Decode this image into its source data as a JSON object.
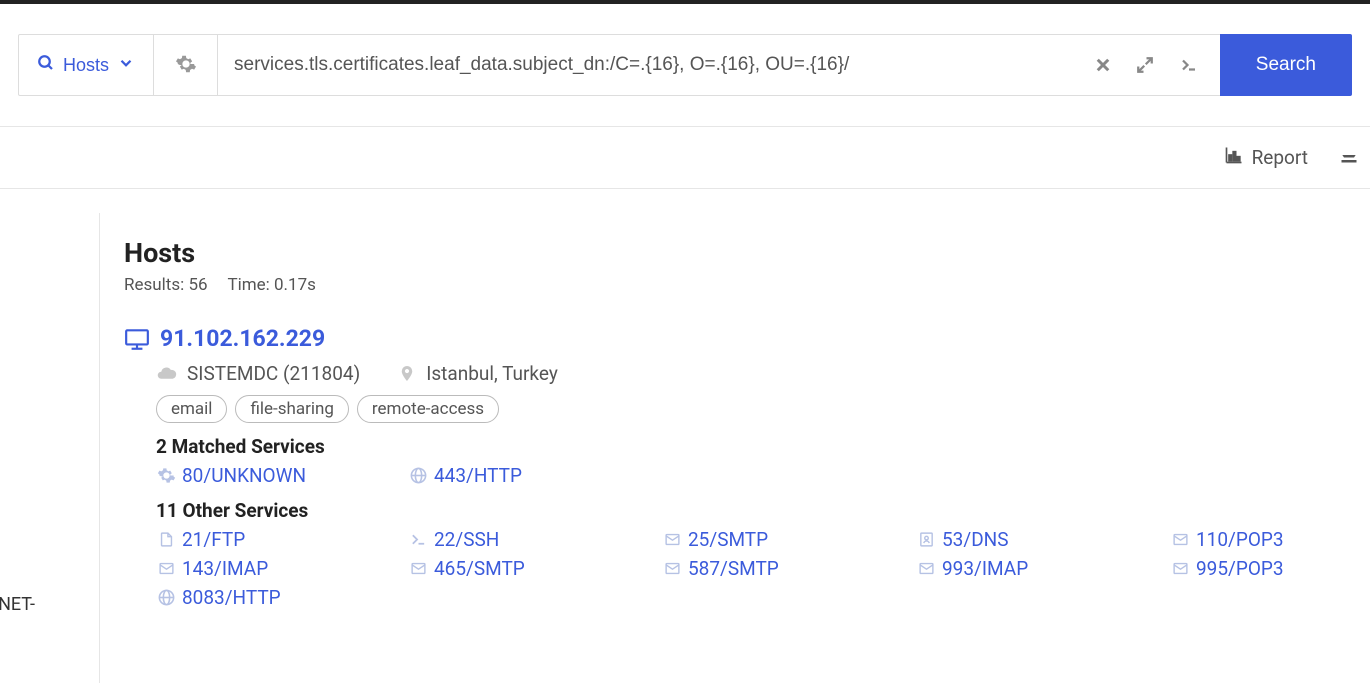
{
  "search": {
    "scope_label": "Hosts",
    "query": "services.tls.certificates.leaf_data.subject_dn:/C=.{16}, O=.{16}, OU=.{16}/",
    "button_label": "Search"
  },
  "subbar": {
    "report_label": "Report"
  },
  "results": {
    "heading": "Hosts",
    "results_label": "Results: 56",
    "time_label": "Time: 0.17s"
  },
  "sidebar": {
    "net_fragment": "NET-"
  },
  "host": {
    "ip": "91.102.162.229",
    "asn": "SISTEMDC (211804)",
    "location": "Istanbul, Turkey",
    "tags": [
      "email",
      "file-sharing",
      "remote-access"
    ],
    "matched_heading": "2 Matched Services",
    "matched": [
      {
        "icon": "gear",
        "label": "80/UNKNOWN"
      },
      {
        "icon": "globe",
        "label": "443/HTTP"
      }
    ],
    "other_heading": "11 Other Services",
    "other": [
      {
        "icon": "file",
        "label": "21/FTP"
      },
      {
        "icon": "terminal",
        "label": "22/SSH"
      },
      {
        "icon": "envelope",
        "label": "25/SMTP"
      },
      {
        "icon": "address",
        "label": "53/DNS"
      },
      {
        "icon": "envelope",
        "label": "110/POP3"
      },
      {
        "icon": "envelope",
        "label": "143/IMAP"
      },
      {
        "icon": "envelope",
        "label": "465/SMTP"
      },
      {
        "icon": "envelope",
        "label": "587/SMTP"
      },
      {
        "icon": "envelope",
        "label": "993/IMAP"
      },
      {
        "icon": "envelope",
        "label": "995/POP3"
      },
      {
        "icon": "globe",
        "label": "8083/HTTP"
      }
    ]
  }
}
